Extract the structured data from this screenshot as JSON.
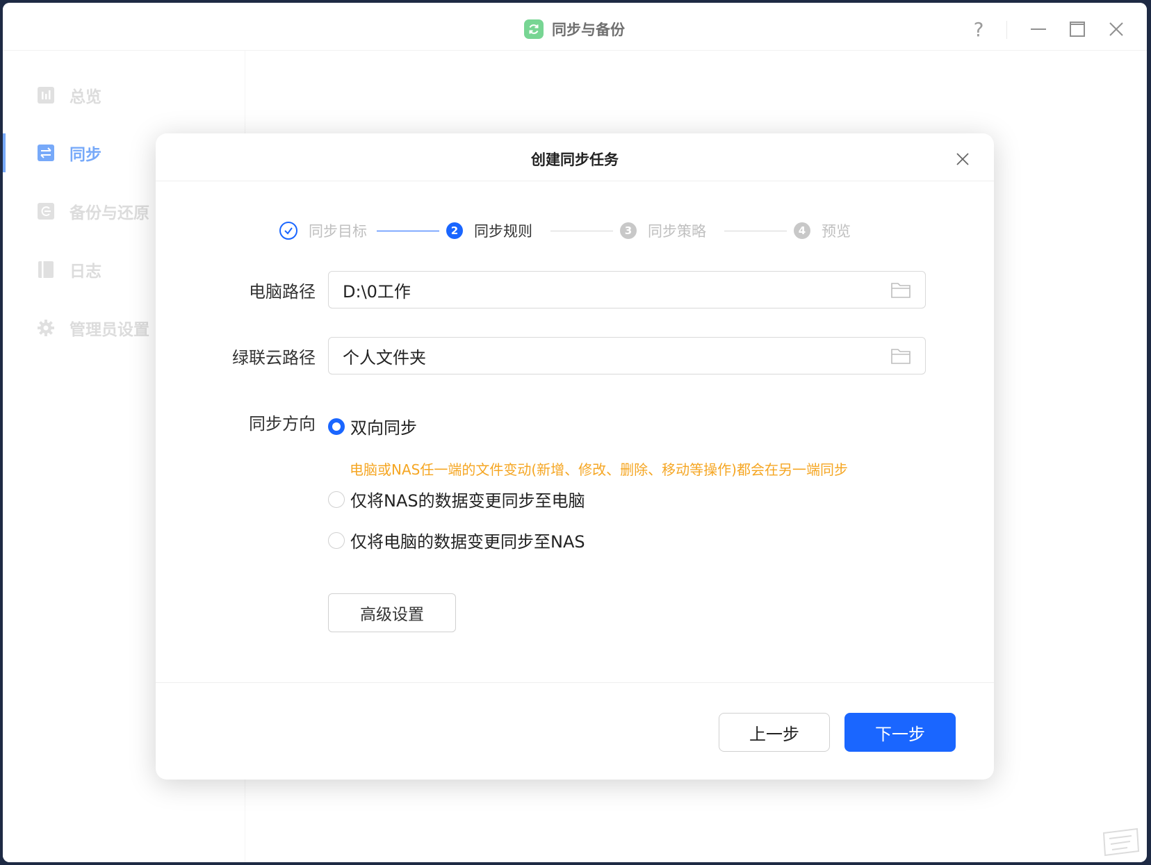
{
  "window": {
    "title": "同步与备份",
    "help_label": "?"
  },
  "sidebar": {
    "items": [
      {
        "label": "总览",
        "icon": "chart-icon"
      },
      {
        "label": "同步",
        "icon": "sync-arrows-icon",
        "active": true
      },
      {
        "label": "备份与还原",
        "icon": "backup-restore-icon"
      },
      {
        "label": "日志",
        "icon": "log-book-icon"
      },
      {
        "label": "管理员设置",
        "icon": "gear-icon"
      }
    ]
  },
  "modal": {
    "title": "创建同步任务",
    "steps": [
      {
        "number": "1",
        "label": "同步目标",
        "state": "done"
      },
      {
        "number": "2",
        "label": "同步规则",
        "state": "current"
      },
      {
        "number": "3",
        "label": "同步策略",
        "state": "pending"
      },
      {
        "number": "4",
        "label": "预览",
        "state": "pending"
      }
    ],
    "pc_path": {
      "label": "电脑路径",
      "value": "D:\\0工作"
    },
    "cloud_path": {
      "label": "绿联云路径",
      "value": "个人文件夹"
    },
    "direction": {
      "label": "同步方向",
      "options": [
        {
          "label": "双向同步",
          "checked": true
        },
        {
          "label": "仅将NAS的数据变更同步至电脑",
          "checked": false
        },
        {
          "label": "仅将电脑的数据变更同步至NAS",
          "checked": false
        }
      ],
      "hint": "电脑或NAS任一端的文件变动(新增、修改、删除、移动等操作)都会在另一端同步"
    },
    "advanced_label": "高级设置",
    "prev_label": "上一步",
    "next_label": "下一步"
  },
  "colors": {
    "accent": "#1a66ff",
    "hint": "#f5a623",
    "app_logo": "#2fbf5a"
  }
}
